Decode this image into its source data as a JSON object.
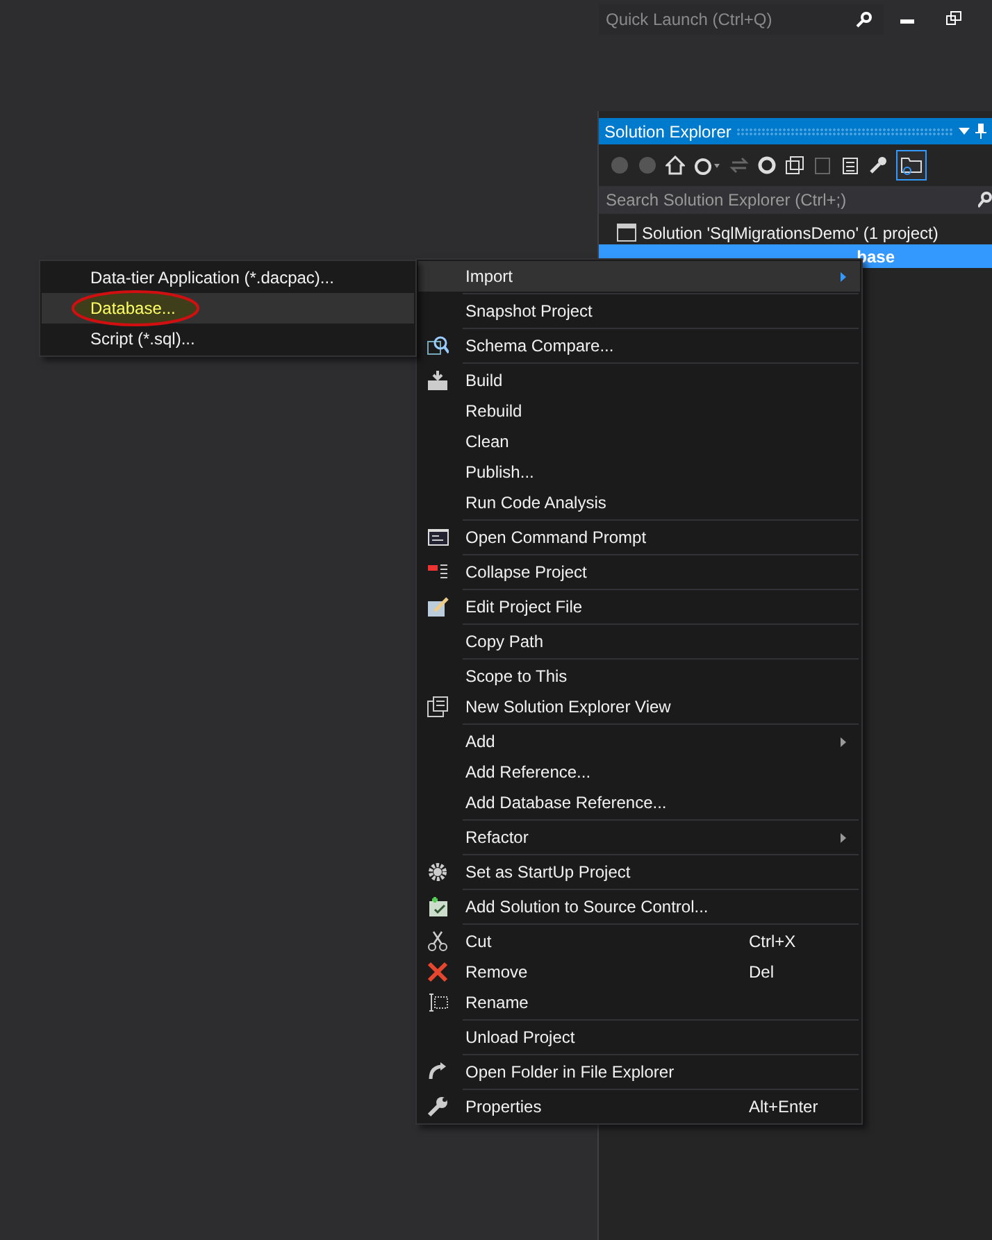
{
  "quick_launch": {
    "placeholder": "Quick Launch (Ctrl+Q)"
  },
  "solution_explorer": {
    "title": "Solution Explorer",
    "search": {
      "placeholder": "Search Solution Explorer (Ctrl+;)"
    },
    "tree": [
      {
        "label": "Solution 'SqlMigrationsDemo' (1 project)",
        "selected": false,
        "children": [
          {
            "label": "base",
            "selected": true
          }
        ]
      }
    ]
  },
  "submenu": {
    "items": [
      {
        "label": "Data-tier Application (*.dacpac)...",
        "selected": false,
        "circled": false
      },
      {
        "label": "Database...",
        "selected": true,
        "circled": true
      },
      {
        "label": "Script (*.sql)...",
        "selected": false,
        "circled": false
      }
    ]
  },
  "context_menu": {
    "items": [
      {
        "kind": "item",
        "label": "Import",
        "submenu": true,
        "selected": true
      },
      {
        "kind": "separator"
      },
      {
        "kind": "item",
        "label": "Snapshot Project",
        "submenu": false,
        "selected": false
      },
      {
        "kind": "separator"
      },
      {
        "kind": "item",
        "label": "Schema Compare...",
        "submenu": false,
        "selected": false
      },
      {
        "kind": "separator"
      },
      {
        "kind": "item",
        "label": "Build",
        "submenu": false,
        "selected": false
      },
      {
        "kind": "item",
        "label": "Rebuild",
        "submenu": false,
        "selected": false
      },
      {
        "kind": "item",
        "label": "Clean",
        "submenu": false,
        "selected": false
      },
      {
        "kind": "item",
        "label": "Publish...",
        "submenu": false,
        "selected": false
      },
      {
        "kind": "item",
        "label": "Run Code Analysis",
        "submenu": false,
        "selected": false
      },
      {
        "kind": "separator"
      },
      {
        "kind": "item",
        "label": "Open Command Prompt",
        "submenu": false,
        "selected": false
      },
      {
        "kind": "separator"
      },
      {
        "kind": "item",
        "label": "Collapse Project",
        "submenu": false,
        "selected": false
      },
      {
        "kind": "separator"
      },
      {
        "kind": "item",
        "label": "Edit Project File",
        "submenu": false,
        "selected": false
      },
      {
        "kind": "separator"
      },
      {
        "kind": "item",
        "label": "Copy Path",
        "submenu": false,
        "selected": false
      },
      {
        "kind": "separator"
      },
      {
        "kind": "item",
        "label": "Scope to This",
        "submenu": false,
        "selected": false
      },
      {
        "kind": "item",
        "label": "New Solution Explorer View",
        "submenu": false,
        "selected": false
      },
      {
        "kind": "separator"
      },
      {
        "kind": "item",
        "label": "Add",
        "submenu": true,
        "selected": false
      },
      {
        "kind": "item",
        "label": "Add Reference...",
        "submenu": false,
        "selected": false
      },
      {
        "kind": "item",
        "label": "Add Database Reference...",
        "submenu": false,
        "selected": false
      },
      {
        "kind": "separator"
      },
      {
        "kind": "item",
        "label": "Refactor",
        "submenu": true,
        "selected": false
      },
      {
        "kind": "separator"
      },
      {
        "kind": "item",
        "label": "Set as StartUp Project",
        "submenu": false,
        "selected": false
      },
      {
        "kind": "separator"
      },
      {
        "kind": "item",
        "label": "Add Solution to Source Control...",
        "submenu": false,
        "selected": false
      },
      {
        "kind": "separator"
      },
      {
        "kind": "item",
        "label": "Cut",
        "shortcut": "Ctrl+X",
        "submenu": false,
        "selected": false
      },
      {
        "kind": "item",
        "label": "Remove",
        "shortcut": "Del",
        "submenu": false,
        "selected": false
      },
      {
        "kind": "item",
        "label": "Rename",
        "submenu": false,
        "selected": false
      },
      {
        "kind": "separator"
      },
      {
        "kind": "item",
        "label": "Unload Project",
        "submenu": false,
        "selected": false
      },
      {
        "kind": "separator"
      },
      {
        "kind": "item",
        "label": "Open Folder in File Explorer",
        "submenu": false,
        "selected": false
      },
      {
        "kind": "separator"
      },
      {
        "kind": "item",
        "label": "Properties",
        "shortcut": "Alt+Enter",
        "submenu": false,
        "selected": false
      }
    ]
  }
}
